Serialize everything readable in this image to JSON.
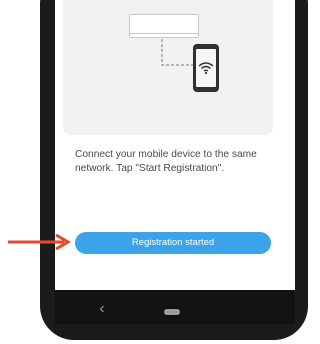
{
  "instructions": {
    "text": "Connect your mobile device to the same network. Tap \"Start Registration\"."
  },
  "primary_button": {
    "label": "Registration started"
  },
  "colors": {
    "accent": "#3ba4e8",
    "arrow": "#e8482c",
    "phone_body": "#1b1b1b",
    "card": "#f1f1f2"
  },
  "icons": {
    "back": "back-icon",
    "home": "home-icon",
    "wifi": "wifi-icon",
    "arrow": "arrow-pointer-icon"
  }
}
